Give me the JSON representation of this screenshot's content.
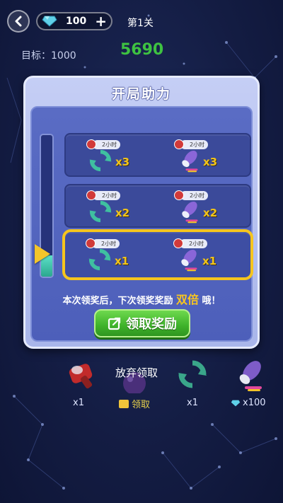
{
  "topbar": {
    "gem_count": "100",
    "plus_label": "+",
    "level": "第1关"
  },
  "goal": {
    "target_label": "目标：1000",
    "score": "5690"
  },
  "dialog": {
    "title": "开局助力",
    "progress_fraction": 0.15,
    "rows": [
      {
        "refresh": {
          "timer": "2小时",
          "qty": "x3"
        },
        "rocket": {
          "timer": "2小时",
          "qty": "x3"
        }
      },
      {
        "refresh": {
          "timer": "2小时",
          "qty": "x2"
        },
        "rocket": {
          "timer": "2小时",
          "qty": "x2"
        }
      },
      {
        "refresh": {
          "timer": "2小时",
          "qty": "x1"
        },
        "rocket": {
          "timer": "2小时",
          "qty": "x1"
        }
      }
    ],
    "bonus_text_before": "本次领奖后，下次领奖奖励 ",
    "bonus_highlight": "双倍",
    "bonus_text_after": " 哦！",
    "claim_button": "领取奖励"
  },
  "bottom": {
    "abandon": "放弃领取",
    "tools": [
      {
        "icon": "hammer-icon",
        "label": "x1"
      },
      {
        "icon": "bomb-icon",
        "label": "领取"
      },
      {
        "icon": "refresh-icon",
        "label": "x1"
      },
      {
        "icon": "rocket-icon",
        "label": "x100"
      }
    ]
  },
  "colors": {
    "accent_gold": "#f5c51e",
    "score_green": "#3ec241",
    "button_green": "#3eb22a"
  }
}
